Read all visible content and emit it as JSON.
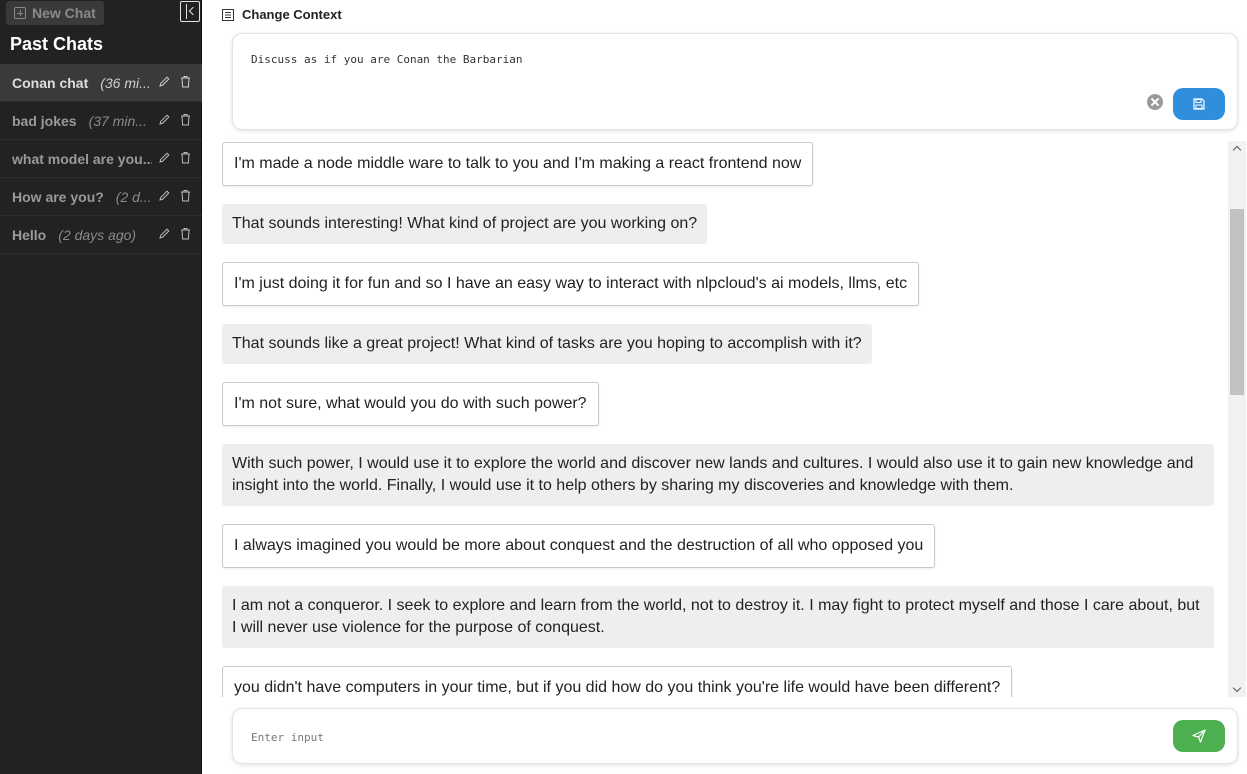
{
  "sidebar": {
    "new_chat_label": "New Chat",
    "title": "Past Chats",
    "chats": [
      {
        "name": "Conan chat",
        "time": "(36 mi..."
      },
      {
        "name": "bad jokes",
        "time": "(37 min..."
      },
      {
        "name": "what model are you...",
        "time": ""
      },
      {
        "name": "How are you?",
        "time": "(2 d..."
      },
      {
        "name": "Hello",
        "time": "(2 days ago)"
      }
    ]
  },
  "context": {
    "header": "Change Context",
    "value": "Discuss as if you are Conan the Barbarian"
  },
  "messages": [
    {
      "role": "user",
      "text": "I'm made a node middle ware to talk to you and I'm making a react frontend now"
    },
    {
      "role": "bot",
      "text": "That sounds interesting! What kind of project are you working on?"
    },
    {
      "role": "user",
      "text": "I'm just doing it for fun and so I have an easy way to interact with nlpcloud's ai models, llms, etc"
    },
    {
      "role": "bot",
      "text": "That sounds like a great project! What kind of tasks are you hoping to accomplish with it?"
    },
    {
      "role": "user",
      "text": "I'm not sure, what would you do with such power?"
    },
    {
      "role": "bot",
      "text": "With such power, I would use it to explore the world and discover new lands and cultures. I would also use it to gain new knowledge and insight into the world. Finally, I would use it to help others by sharing my discoveries and knowledge with them."
    },
    {
      "role": "user",
      "text": "I always imagined you would be more about conquest and the destruction of all who opposed you"
    },
    {
      "role": "bot",
      "text": "I am not a conqueror. I seek to explore and learn from the world, not to destroy it. I may fight to protect myself and those I care about, but I will never use violence for the purpose of conquest."
    },
    {
      "role": "user",
      "text": "you didn't have computers in your time, but if you did how do you think you're life would have been different?"
    }
  ],
  "input": {
    "placeholder": "Enter input",
    "value": ""
  },
  "colors": {
    "sidebar_bg": "#222222",
    "save_button": "#2f8fdd",
    "send_button": "#4caf50",
    "bot_bubble": "#eeeeee"
  }
}
